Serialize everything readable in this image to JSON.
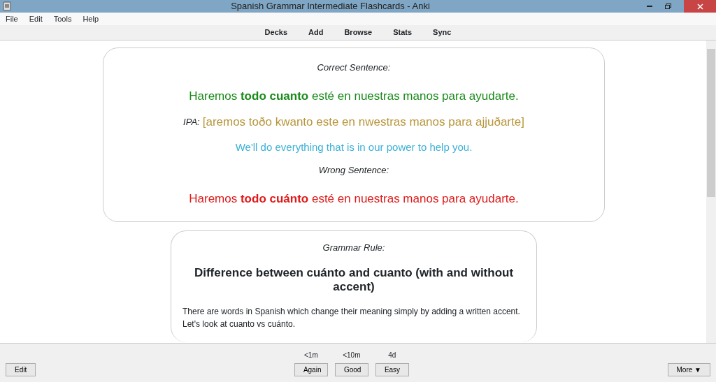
{
  "window": {
    "title": "Spanish Grammar Intermediate Flashcards - Anki"
  },
  "menu": [
    "File",
    "Edit",
    "Tools",
    "Help"
  ],
  "toolbar": [
    "Decks",
    "Add",
    "Browse",
    "Stats",
    "Sync"
  ],
  "question_card": {
    "correct_label": "Correct Sentence:",
    "correct_sentence": "Haremos **todo cuanto** esté en nuestras manos para ayudarte.",
    "ipa_label": "IPA:",
    "ipa": "[aremos toðo kwanto este en nwestras manos para ajjuðarte]",
    "translation": "We'll do everything that is in our power to help you.",
    "wrong_label": "Wrong Sentence:",
    "wrong_sentence": "Haremos **todo cuánto** esté en nuestras manos para ayudarte."
  },
  "rule_card": {
    "label": "Grammar Rule:",
    "heading": "Difference between cuánto and cuanto (with and without accent)",
    "text": "There are words in Spanish which change their meaning simply by adding a written accent. Let's look at cuanto vs cuánto."
  },
  "bottom_bar": {
    "edit_button": "Edit",
    "answers": [
      {
        "due": "<1m",
        "label": "Again"
      },
      {
        "due": "<10m",
        "label": "Good"
      },
      {
        "due": "4d",
        "label": "Easy"
      }
    ],
    "more_button": "More ▼"
  }
}
